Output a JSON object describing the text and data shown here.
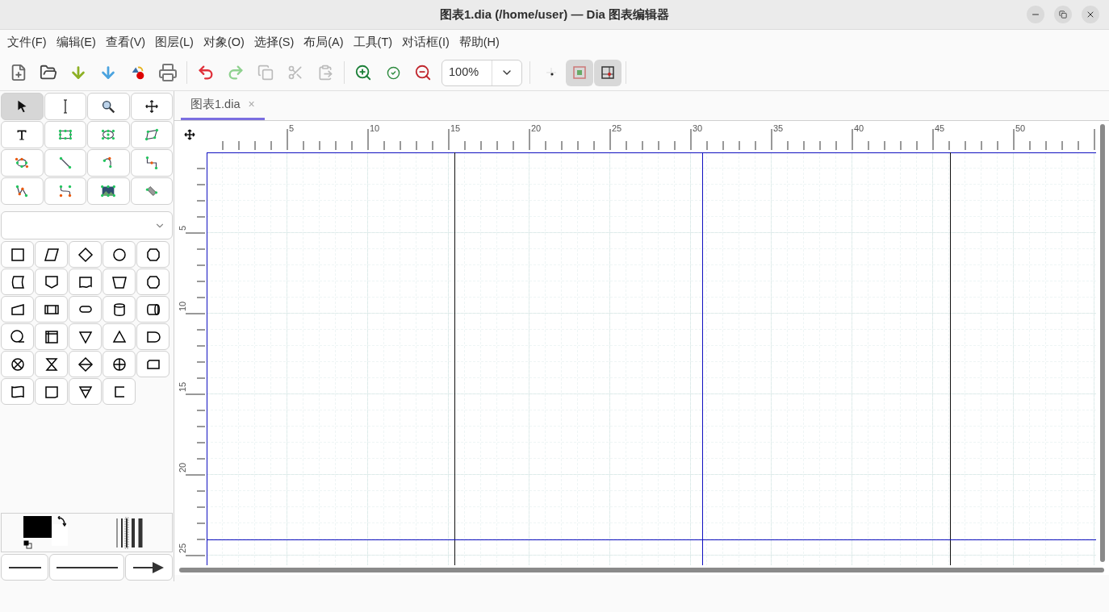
{
  "window": {
    "title": "图表1.dia (/home/user) — Dia 图表编辑器"
  },
  "menu": [
    "文件(F)",
    "编辑(E)",
    "查看(V)",
    "图层(L)",
    "对象(O)",
    "选择(S)",
    "布局(A)",
    "工具(T)",
    "对话框(I)",
    "帮助(H)"
  ],
  "toolbar": {
    "zoom": "100%",
    "toggles": [
      {
        "selected": false
      },
      {
        "selected": true
      },
      {
        "selected": true
      }
    ]
  },
  "tools": [
    {
      "selected": true
    },
    {
      "selected": false
    },
    {
      "selected": false
    },
    {
      "selected": false
    },
    {
      "selected": false
    },
    {
      "selected": false
    },
    {
      "selected": false
    },
    {
      "selected": false
    },
    {
      "selected": false
    },
    {
      "selected": false
    },
    {
      "selected": false
    },
    {
      "selected": false
    },
    {
      "selected": false
    },
    {
      "selected": false
    },
    {
      "selected": false
    },
    {
      "selected": false
    }
  ],
  "tab": {
    "label": "图表1.dia",
    "selected": true,
    "close": "×"
  },
  "rulers": {
    "horizontal": [
      "5",
      "10",
      "15",
      "20",
      "25",
      "30",
      "35",
      "40",
      "45",
      "50"
    ],
    "vertical": [
      "5",
      "10",
      "15",
      "20",
      "25"
    ]
  }
}
